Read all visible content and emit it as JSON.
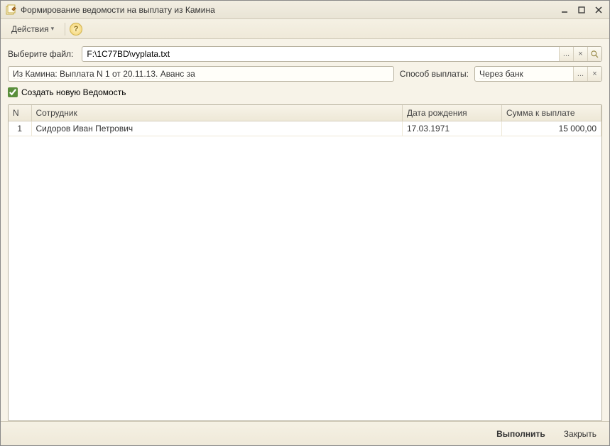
{
  "window": {
    "title": "Формирование ведомости на выплату из Камина"
  },
  "toolbar": {
    "actions_label": "Действия"
  },
  "fields": {
    "file_label": "Выберите файл:",
    "file_value": "F:\\1C77BD\\vyplata.txt",
    "kamin_value": "Из Камина: Выплата N 1 от 20.11.13. Аванс за",
    "method_label": "Способ выплаты:",
    "method_value": "Через банк",
    "create_new_label": "Создать новую Ведомость"
  },
  "icons": {
    "ellipsis": "...",
    "clear": "×"
  },
  "table": {
    "headers": {
      "n": "N",
      "employee": "Сотрудник",
      "dob": "Дата рождения",
      "sum": "Сумма к выплате"
    },
    "rows": [
      {
        "n": "1",
        "employee": "Сидоров Иван Петрович",
        "dob": "17.03.1971",
        "sum": "15 000,00"
      }
    ]
  },
  "footer": {
    "execute": "Выполнить",
    "close": "Закрыть"
  }
}
